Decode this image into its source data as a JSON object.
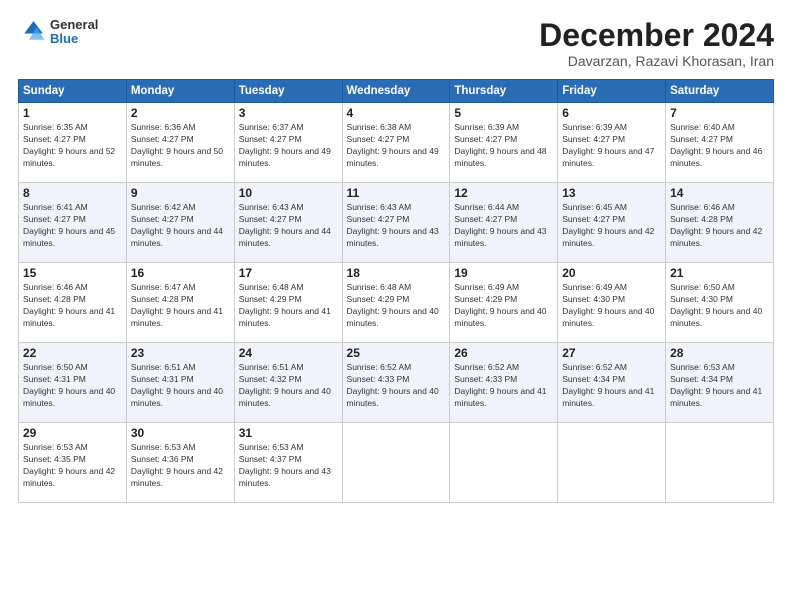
{
  "logo": {
    "general": "General",
    "blue": "Blue"
  },
  "title": "December 2024",
  "subtitle": "Davarzan, Razavi Khorasan, Iran",
  "headers": [
    "Sunday",
    "Monday",
    "Tuesday",
    "Wednesday",
    "Thursday",
    "Friday",
    "Saturday"
  ],
  "weeks": [
    [
      {
        "day": "1",
        "sunrise": "6:35 AM",
        "sunset": "4:27 PM",
        "daylight": "9 hours and 52 minutes."
      },
      {
        "day": "2",
        "sunrise": "6:36 AM",
        "sunset": "4:27 PM",
        "daylight": "9 hours and 50 minutes."
      },
      {
        "day": "3",
        "sunrise": "6:37 AM",
        "sunset": "4:27 PM",
        "daylight": "9 hours and 49 minutes."
      },
      {
        "day": "4",
        "sunrise": "6:38 AM",
        "sunset": "4:27 PM",
        "daylight": "9 hours and 49 minutes."
      },
      {
        "day": "5",
        "sunrise": "6:39 AM",
        "sunset": "4:27 PM",
        "daylight": "9 hours and 48 minutes."
      },
      {
        "day": "6",
        "sunrise": "6:39 AM",
        "sunset": "4:27 PM",
        "daylight": "9 hours and 47 minutes."
      },
      {
        "day": "7",
        "sunrise": "6:40 AM",
        "sunset": "4:27 PM",
        "daylight": "9 hours and 46 minutes."
      }
    ],
    [
      {
        "day": "8",
        "sunrise": "6:41 AM",
        "sunset": "4:27 PM",
        "daylight": "9 hours and 45 minutes."
      },
      {
        "day": "9",
        "sunrise": "6:42 AM",
        "sunset": "4:27 PM",
        "daylight": "9 hours and 44 minutes."
      },
      {
        "day": "10",
        "sunrise": "6:43 AM",
        "sunset": "4:27 PM",
        "daylight": "9 hours and 44 minutes."
      },
      {
        "day": "11",
        "sunrise": "6:43 AM",
        "sunset": "4:27 PM",
        "daylight": "9 hours and 43 minutes."
      },
      {
        "day": "12",
        "sunrise": "6:44 AM",
        "sunset": "4:27 PM",
        "daylight": "9 hours and 43 minutes."
      },
      {
        "day": "13",
        "sunrise": "6:45 AM",
        "sunset": "4:27 PM",
        "daylight": "9 hours and 42 minutes."
      },
      {
        "day": "14",
        "sunrise": "6:46 AM",
        "sunset": "4:28 PM",
        "daylight": "9 hours and 42 minutes."
      }
    ],
    [
      {
        "day": "15",
        "sunrise": "6:46 AM",
        "sunset": "4:28 PM",
        "daylight": "9 hours and 41 minutes."
      },
      {
        "day": "16",
        "sunrise": "6:47 AM",
        "sunset": "4:28 PM",
        "daylight": "9 hours and 41 minutes."
      },
      {
        "day": "17",
        "sunrise": "6:48 AM",
        "sunset": "4:29 PM",
        "daylight": "9 hours and 41 minutes."
      },
      {
        "day": "18",
        "sunrise": "6:48 AM",
        "sunset": "4:29 PM",
        "daylight": "9 hours and 40 minutes."
      },
      {
        "day": "19",
        "sunrise": "6:49 AM",
        "sunset": "4:29 PM",
        "daylight": "9 hours and 40 minutes."
      },
      {
        "day": "20",
        "sunrise": "6:49 AM",
        "sunset": "4:30 PM",
        "daylight": "9 hours and 40 minutes."
      },
      {
        "day": "21",
        "sunrise": "6:50 AM",
        "sunset": "4:30 PM",
        "daylight": "9 hours and 40 minutes."
      }
    ],
    [
      {
        "day": "22",
        "sunrise": "6:50 AM",
        "sunset": "4:31 PM",
        "daylight": "9 hours and 40 minutes."
      },
      {
        "day": "23",
        "sunrise": "6:51 AM",
        "sunset": "4:31 PM",
        "daylight": "9 hours and 40 minutes."
      },
      {
        "day": "24",
        "sunrise": "6:51 AM",
        "sunset": "4:32 PM",
        "daylight": "9 hours and 40 minutes."
      },
      {
        "day": "25",
        "sunrise": "6:52 AM",
        "sunset": "4:33 PM",
        "daylight": "9 hours and 40 minutes."
      },
      {
        "day": "26",
        "sunrise": "6:52 AM",
        "sunset": "4:33 PM",
        "daylight": "9 hours and 41 minutes."
      },
      {
        "day": "27",
        "sunrise": "6:52 AM",
        "sunset": "4:34 PM",
        "daylight": "9 hours and 41 minutes."
      },
      {
        "day": "28",
        "sunrise": "6:53 AM",
        "sunset": "4:34 PM",
        "daylight": "9 hours and 41 minutes."
      }
    ],
    [
      {
        "day": "29",
        "sunrise": "6:53 AM",
        "sunset": "4:35 PM",
        "daylight": "9 hours and 42 minutes."
      },
      {
        "day": "30",
        "sunrise": "6:53 AM",
        "sunset": "4:36 PM",
        "daylight": "9 hours and 42 minutes."
      },
      {
        "day": "31",
        "sunrise": "6:53 AM",
        "sunset": "4:37 PM",
        "daylight": "9 hours and 43 minutes."
      },
      null,
      null,
      null,
      null
    ]
  ]
}
